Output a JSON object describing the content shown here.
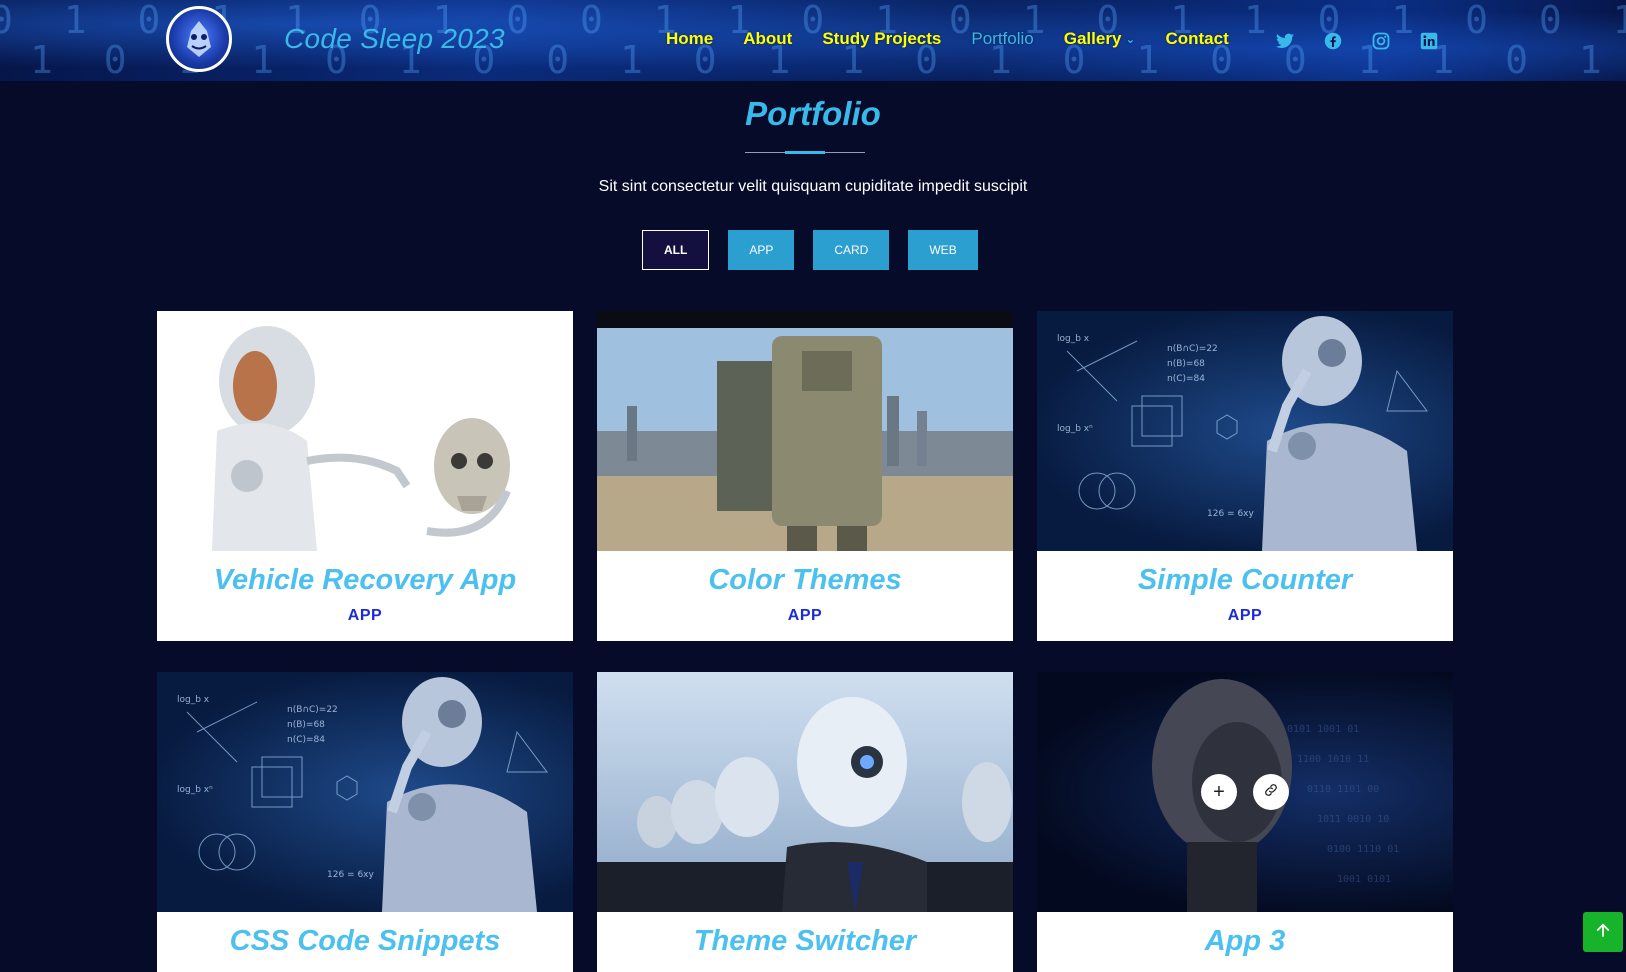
{
  "header": {
    "brand": "Code Sleep 2023",
    "nav": [
      {
        "label": "Home",
        "active": false
      },
      {
        "label": "About",
        "active": false
      },
      {
        "label": "Study Projects",
        "active": false
      },
      {
        "label": "Portfolio",
        "active": true
      },
      {
        "label": "Gallery",
        "active": false,
        "dropdown": true
      },
      {
        "label": "Contact",
        "active": false
      }
    ],
    "social_icons": [
      "twitter-icon",
      "facebook-icon",
      "instagram-icon",
      "linkedin-icon"
    ]
  },
  "portfolio": {
    "title": "Portfolio",
    "subtitle": "Sit sint consectetur velit quisquam cupiditate impedit suscipit",
    "filters": [
      {
        "label": "ALL",
        "active": true
      },
      {
        "label": "APP",
        "active": false
      },
      {
        "label": "CARD",
        "active": false
      },
      {
        "label": "WEB",
        "active": false
      }
    ],
    "items": [
      {
        "title": "Vehicle Recovery App",
        "category": "APP"
      },
      {
        "title": "Color Themes",
        "category": "APP"
      },
      {
        "title": "Simple Counter",
        "category": "APP"
      },
      {
        "title": "CSS Code Snippets",
        "category": ""
      },
      {
        "title": "Theme Switcher",
        "category": ""
      },
      {
        "title": "App 3",
        "category": ""
      }
    ]
  },
  "colors": {
    "accent": "#39b9ea",
    "nav_text": "#ffff00",
    "background": "#060b2a",
    "filter_bg": "#2b9fcf",
    "category": "#1b2cd6",
    "back_to_top": "#16b32b"
  }
}
